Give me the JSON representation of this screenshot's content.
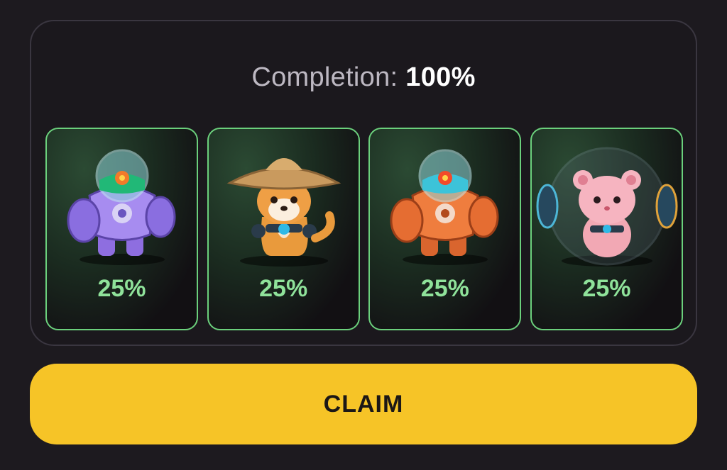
{
  "completion": {
    "label": "Completion:",
    "value": "100%"
  },
  "cards": [
    {
      "name": "purple-mech-robot",
      "percent": "25%"
    },
    {
      "name": "shiba-dog-with-straw-hat",
      "percent": "25%"
    },
    {
      "name": "orange-mech-robot",
      "percent": "25%"
    },
    {
      "name": "hamster-in-ball",
      "percent": "25%"
    }
  ],
  "claim_button": {
    "label": "CLAIM"
  },
  "colors": {
    "background": "#1d1a1f",
    "card_border": "#6bd07c",
    "percent_text": "#8fe29a",
    "claim_button": "#f6c427"
  }
}
